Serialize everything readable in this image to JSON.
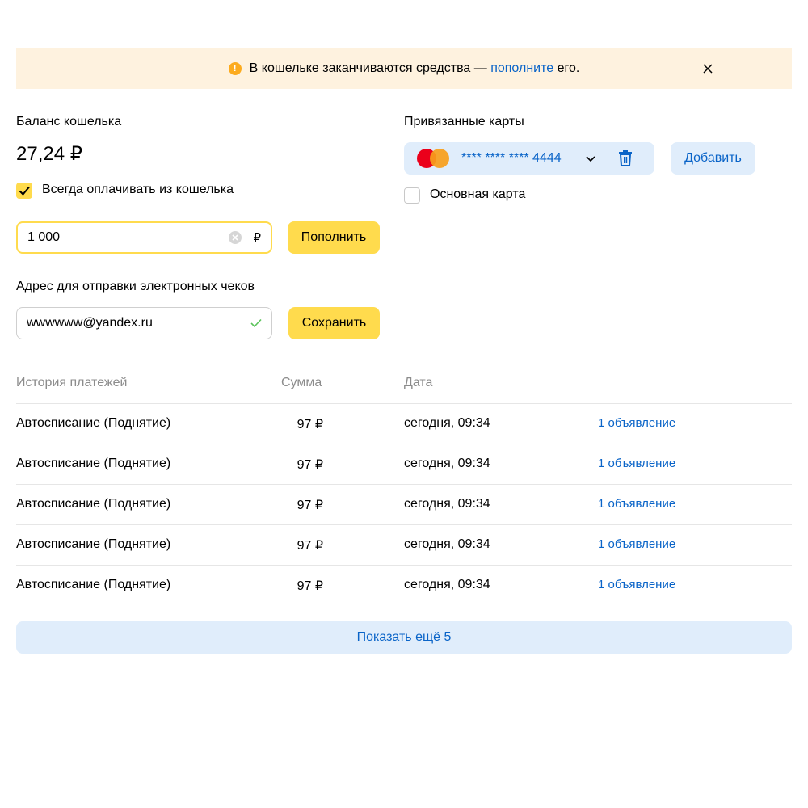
{
  "banner": {
    "text_before": "В кошельке заканчиваются средства — ",
    "link": "пополните",
    "text_after": " его.",
    "warn_symbol": "!"
  },
  "wallet": {
    "title": "Баланс кошелька",
    "balance": "27,24 ₽",
    "always_pay_label": "Всегда оплачивать из кошелька",
    "always_pay_checked": true,
    "amount_value": "1 000",
    "currency": "₽",
    "topup_button": "Пополнить"
  },
  "receipts": {
    "title": "Адрес для отправки электронных чеков",
    "email_value": "wwwwww@yandex.ru",
    "save_button": "Сохранить"
  },
  "cards": {
    "title": "Привязанные карты",
    "card_number": "**** **** **** 4444",
    "add_button": "Добавить",
    "main_card_label": "Основная карта",
    "main_card_checked": false
  },
  "history": {
    "headers": {
      "description": "История платежей",
      "amount": "Сумма",
      "date": "Дата"
    },
    "rows": [
      {
        "description": "Автосписание (Поднятие)",
        "amount": "97 ₽",
        "date": "сегодня, 09:34",
        "link": "1 объявление"
      },
      {
        "description": "Автосписание (Поднятие)",
        "amount": "97 ₽",
        "date": "сегодня, 09:34",
        "link": "1 объявление"
      },
      {
        "description": "Автосписание (Поднятие)",
        "amount": "97 ₽",
        "date": "сегодня, 09:34",
        "link": "1 объявление"
      },
      {
        "description": "Автосписание (Поднятие)",
        "amount": "97 ₽",
        "date": "сегодня, 09:34",
        "link": "1 объявление"
      },
      {
        "description": "Автосписание (Поднятие)",
        "amount": "97 ₽",
        "date": "сегодня, 09:34",
        "link": "1 объявление"
      }
    ],
    "show_more_button": "Показать ещё 5"
  },
  "colors": {
    "accent_yellow": "#ffdb4d",
    "link_blue": "#0a64c8",
    "banner_bg": "#fef2df",
    "light_blue_bg": "#e0edfb",
    "warning_orange": "#fcab1e"
  },
  "icons": [
    "warning-icon",
    "close-icon",
    "check-icon",
    "clear-icon",
    "success-check-icon",
    "mastercard-logo",
    "chevron-down-icon",
    "trash-icon"
  ]
}
